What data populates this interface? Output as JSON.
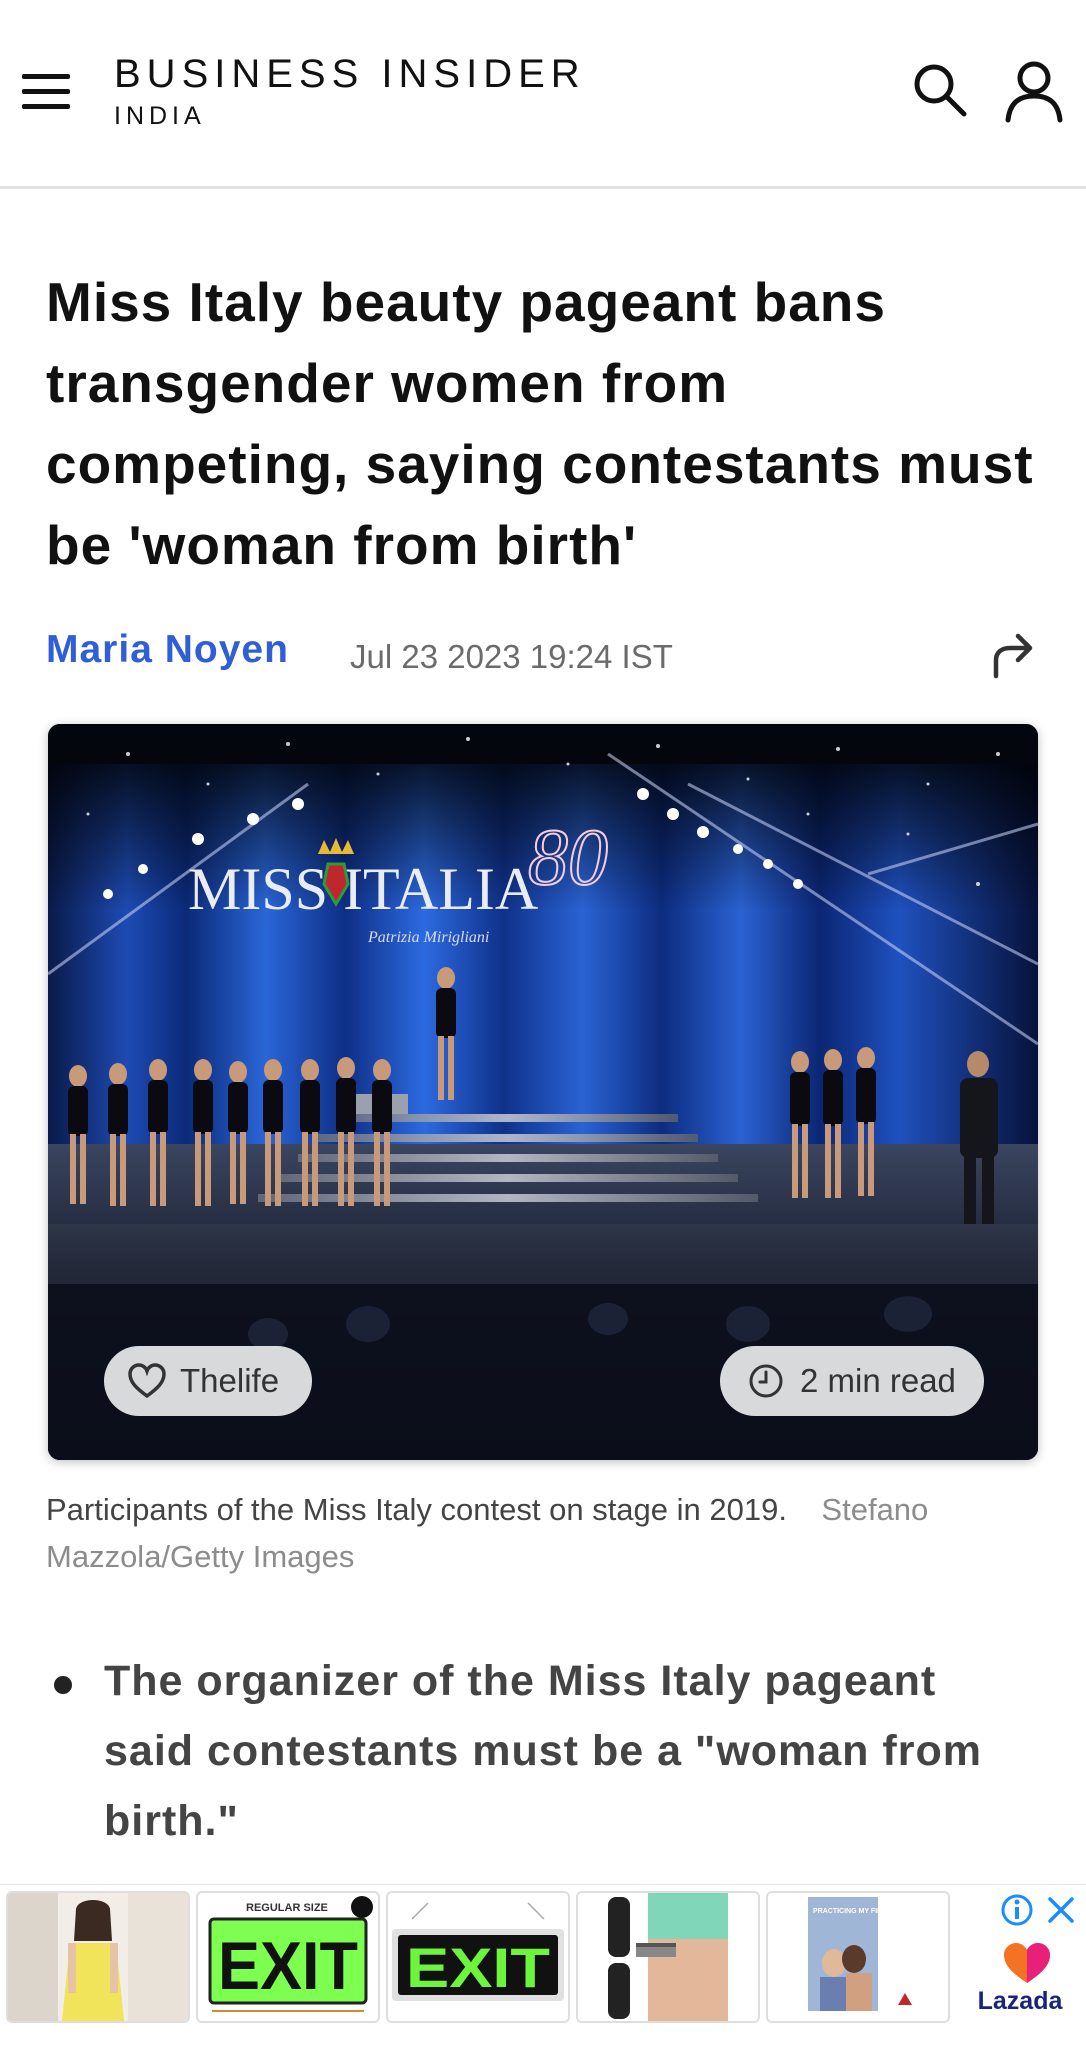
{
  "header": {
    "brand_title": "BUSINESS INSIDER",
    "brand_subtitle": "INDIA"
  },
  "article": {
    "headline": "Miss Italy beauty pageant bans transgender women from competing, saying contestants must be 'woman from birth'",
    "author": "Maria Noyen",
    "date": "Jul 23 2023 19:24 IST"
  },
  "hero": {
    "stage_logo_text": "MISS ITALIA",
    "stage_logo_number": "80",
    "stage_logo_signature": "Patrizia Mirigliani",
    "tag_label": "Thelife",
    "read_time": "2 min read"
  },
  "caption": {
    "text": "Participants of the Miss Italy contest on stage in 2019.",
    "credit": "Stefano Mazzola/Getty Images"
  },
  "bullets": [
    "The organizer of the Miss Italy pageant said contestants must be a \"woman from birth.\""
  ],
  "ad": {
    "card2_top_text": "REGULAR SIZE",
    "card2_exit": "EXIT",
    "card3_exit": "EXIT",
    "card5_text": "PRACTICING MY FIRST REAL KISS",
    "advertiser": "Lazada"
  },
  "colors": {
    "author_link": "#2f5ed6",
    "exit_green": "#7cff4f",
    "lazada_orange": "#f57224",
    "lazada_pink": "#e8207a",
    "info_blue": "#1a8cff"
  }
}
